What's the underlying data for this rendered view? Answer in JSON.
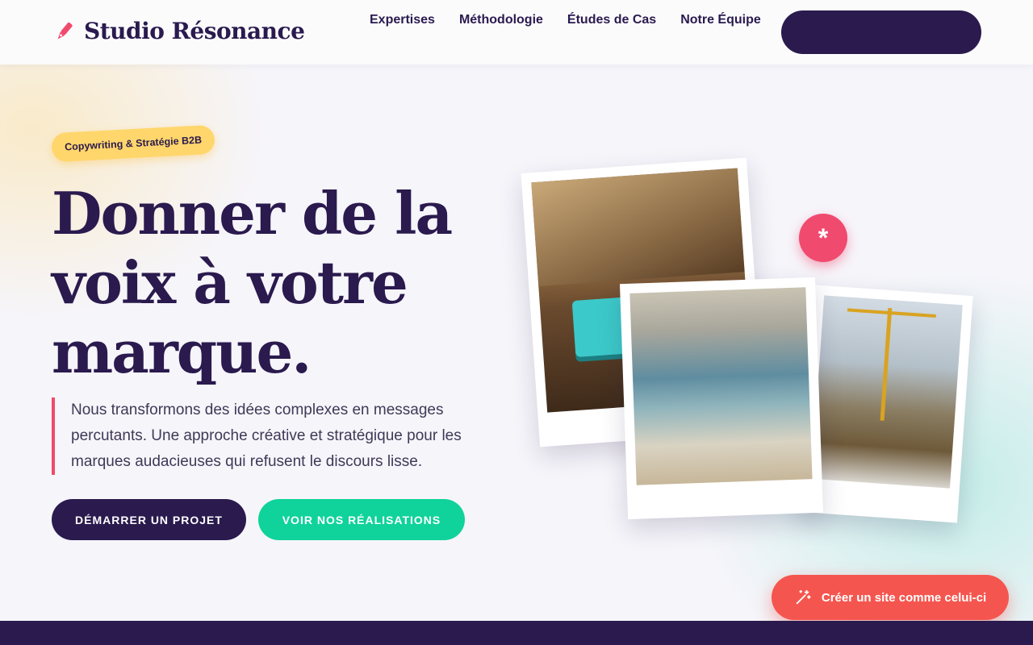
{
  "header": {
    "logo_text": "Studio Résonance",
    "logo_icon": "pen-nib-icon",
    "nav": [
      "Expertises",
      "Méthodologie",
      "Études de Cas",
      "Notre Équipe"
    ],
    "cta_label": ""
  },
  "hero": {
    "badge": "Copywriting & Stratégie B2B",
    "title": "Donner de la voix à votre marque.",
    "lead": "Nous transformons des idées complexes en messages percutants. Une approche créative et stratégique pour les marques audacieuses qui refusent le discours lisse.",
    "primary_button": "DÉMARRER UN PROJET",
    "secondary_button": "VOIR NOS RÉALISATIONS",
    "asterisk": "*"
  },
  "gallery": [
    {
      "icon": "typewriter-desk-photo"
    },
    {
      "icon": "ocean-wave-photo"
    },
    {
      "icon": "construction-crane-photo"
    }
  ],
  "floating_cta": {
    "label": "Créer un site comme celui-ci",
    "icon": "magic-wand-icon"
  },
  "colors": {
    "primary": "#2a1a4e",
    "accent_pink": "#f04a6f",
    "accent_green": "#0fd39b",
    "badge_yellow": "#ffd66b",
    "cta_red": "#f4564f"
  }
}
